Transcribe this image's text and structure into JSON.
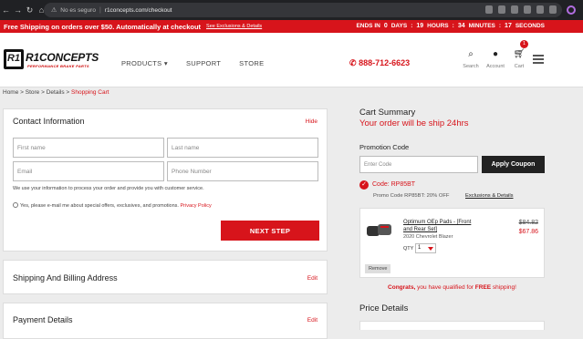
{
  "browser": {
    "insecure": "No es seguro",
    "url": "r1concepts.com/checkout"
  },
  "promo": {
    "text": "Free Shipping on orders over $50. Automatically at checkout",
    "link": "See Exclusions & Details",
    "ends_in": "ENDS IN",
    "days": "0",
    "days_label": "DAYS",
    "hours": "19",
    "hours_label": "HOURS",
    "minutes": "34",
    "minutes_label": "MINUTES",
    "seconds": "17",
    "seconds_label": "SECONDS"
  },
  "header": {
    "logo_mark": "R1",
    "logo_text": "R1CONCEPTS",
    "logo_tagline": "PERFORMANCE BRAKE PARTS",
    "menu": [
      "PRODUCTS ▾",
      "SUPPORT",
      "STORE"
    ],
    "phone": "888-712-6623",
    "search_label": "Search",
    "account_label": "Account",
    "cart_label": "Cart",
    "cart_count": "1"
  },
  "breadcrumb": {
    "items": [
      "Home",
      "Store",
      "Details"
    ],
    "current": "Shopping Cart"
  },
  "contact": {
    "title": "Contact Information",
    "hide": "Hide",
    "first_name": "First name",
    "last_name": "Last name",
    "email": "Email",
    "phone": "Phone Number",
    "privacy_note": "We use your information to process your order and provide you with customer service.",
    "optin": "Yes, please e-mail me about special offers, exclusives, and promotions.",
    "privacy_link": "Privacy Policy",
    "next": "NEXT STEP"
  },
  "shipping": {
    "title": "Shipping And Billing Address",
    "edit": "Edit"
  },
  "payment": {
    "title": "Payment Details",
    "edit": "Edit"
  },
  "summary": {
    "title": "Cart Summary",
    "subtitle": "Your order will be ship 24hrs",
    "promo_label": "Promotion Code",
    "code_placeholder": "Enter Code",
    "apply": "Apply Coupon",
    "code_applied": "Code: RP85BT",
    "promo_detail": "Promo Code RP85BT: 20% OFF",
    "exclusions": "Exclusions & Details",
    "item": {
      "name": "Optimum OEp Pads - [Front and Rear Set]",
      "vehicle": "2020 Chevrolet Blazer",
      "qty_label": "QTY",
      "qty": "1",
      "old_price": "$84.82",
      "new_price": "$67.86",
      "remove": "Remove"
    },
    "congrats_pre": "Congrats,",
    "congrats_mid": " you have qualified for ",
    "congrats_free": "FREE",
    "congrats_post": " shipping!",
    "price_details": "Price Details"
  },
  "colors": {
    "brand_red": "#d7141b",
    "dark": "#222222"
  }
}
